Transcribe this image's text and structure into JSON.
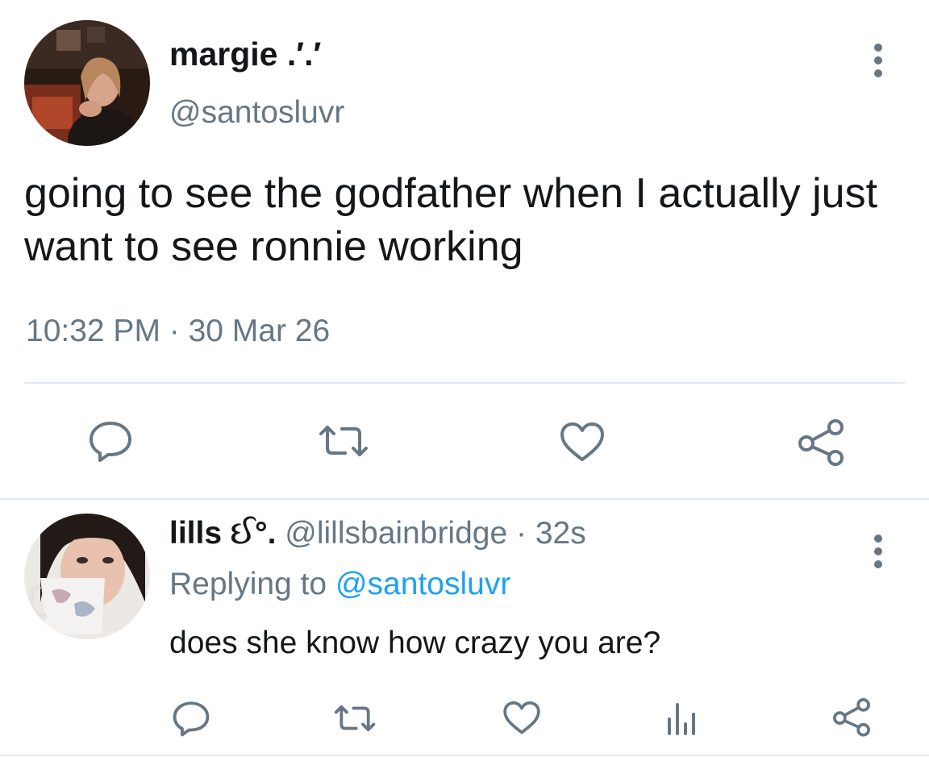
{
  "main_tweet": {
    "display_name": "margie .′.′",
    "handle": "@santosluvr",
    "text": "going to see the godfather when I actually just want to see ronnie working",
    "timestamp": "10:32 PM · 30 Mar 26"
  },
  "reply_tweet": {
    "display_name": "lills ઈ°.",
    "handle_and_time": "@lillsbainbridge · 32s",
    "replying_label": "Replying to",
    "replying_to": "@santosluvr",
    "text": "does she know how crazy you are?"
  },
  "icons": {
    "more": "more-vertical-icon",
    "reply": "reply-icon",
    "retweet": "retweet-icon",
    "like": "like-icon",
    "share": "share-icon",
    "analytics": "analytics-icon"
  },
  "colors": {
    "text": "#14171a",
    "secondary": "#657786",
    "link": "#1da1f2",
    "divider": "#e1e8ed"
  }
}
